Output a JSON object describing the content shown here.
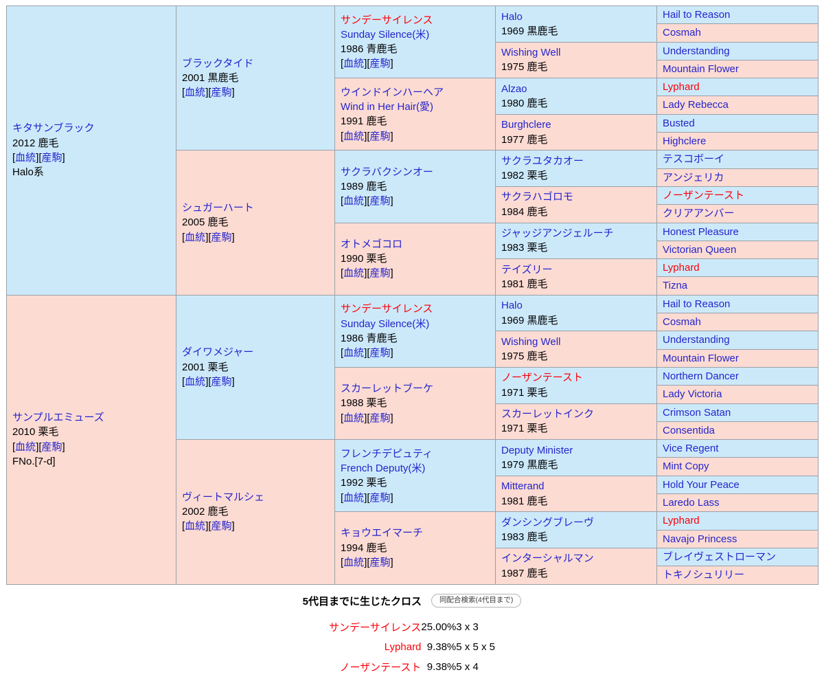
{
  "pedigree": {
    "subject": {
      "name": "キタサンブラック",
      "year_color": "2012 鹿毛",
      "links": [
        "血統",
        "産駒"
      ],
      "line": "Halo系",
      "sex": "m"
    },
    "dam_subject": {
      "name": "サンプルエミューズ",
      "year_color": "2010 栗毛",
      "links": [
        "血統",
        "産駒"
      ],
      "line": "FNo.[7-d]",
      "sex": "f"
    },
    "gen2": [
      {
        "name": "ブラックタイド",
        "year_color": "2001 黒鹿毛",
        "links": [
          "血統",
          "産駒"
        ],
        "sex": "m"
      },
      {
        "name": "シュガーハート",
        "year_color": "2005 鹿毛",
        "links": [
          "血統",
          "産駒"
        ],
        "sex": "f"
      },
      {
        "name": "ダイワメジャー",
        "year_color": "2001 栗毛",
        "links": [
          "血統",
          "産駒"
        ],
        "sex": "m"
      },
      {
        "name": "ヴィートマルシェ",
        "year_color": "2002 鹿毛",
        "links": [
          "血統",
          "産駒"
        ],
        "sex": "f"
      }
    ],
    "gen3": [
      {
        "name": "サンデーサイレンス",
        "en": "Sunday Silence(米)",
        "year_color": "1986 青鹿毛",
        "links": [
          "血統",
          "産駒"
        ],
        "sex": "m",
        "cross": true
      },
      {
        "name": "ウインドインハーヘア",
        "en": "Wind in Her Hair(愛)",
        "year_color": "1991 鹿毛",
        "links": [
          "血統",
          "産駒"
        ],
        "sex": "f",
        "cross": false
      },
      {
        "name": "サクラバクシンオー",
        "en": "",
        "year_color": "1989 鹿毛",
        "links": [
          "血統",
          "産駒"
        ],
        "sex": "m",
        "cross": false
      },
      {
        "name": "オトメゴコロ",
        "en": "",
        "year_color": "1990 栗毛",
        "links": [
          "血統",
          "産駒"
        ],
        "sex": "f",
        "cross": false
      },
      {
        "name": "サンデーサイレンス",
        "en": "Sunday Silence(米)",
        "year_color": "1986 青鹿毛",
        "links": [
          "血統",
          "産駒"
        ],
        "sex": "m",
        "cross": true
      },
      {
        "name": "スカーレットブーケ",
        "en": "",
        "year_color": "1988 栗毛",
        "links": [
          "血統",
          "産駒"
        ],
        "sex": "f",
        "cross": false
      },
      {
        "name": "フレンチデピュティ",
        "en": "French Deputy(米)",
        "year_color": "1992 栗毛",
        "links": [
          "血統",
          "産駒"
        ],
        "sex": "m",
        "cross": false
      },
      {
        "name": "キョウエイマーチ",
        "en": "",
        "year_color": "1994 鹿毛",
        "links": [
          "血統",
          "産駒"
        ],
        "sex": "f",
        "cross": false
      }
    ],
    "gen4": [
      {
        "name": "Halo",
        "year_color": "1969 黒鹿毛",
        "sex": "m",
        "cross": false
      },
      {
        "name": "Wishing Well",
        "year_color": "1975 鹿毛",
        "sex": "f",
        "cross": false
      },
      {
        "name": "Alzao",
        "year_color": "1980 鹿毛",
        "sex": "m",
        "cross": false
      },
      {
        "name": "Burghclere",
        "year_color": "1977 鹿毛",
        "sex": "f",
        "cross": false
      },
      {
        "name": "サクラユタカオー",
        "year_color": "1982 栗毛",
        "sex": "m",
        "cross": false
      },
      {
        "name": "サクラハゴロモ",
        "year_color": "1984 鹿毛",
        "sex": "f",
        "cross": false
      },
      {
        "name": "ジャッジアンジェルーチ",
        "year_color": "1983 栗毛",
        "sex": "m",
        "cross": false
      },
      {
        "name": "テイズリー",
        "year_color": "1981 鹿毛",
        "sex": "f",
        "cross": false
      },
      {
        "name": "Halo",
        "year_color": "1969 黒鹿毛",
        "sex": "m",
        "cross": false
      },
      {
        "name": "Wishing Well",
        "year_color": "1975 鹿毛",
        "sex": "f",
        "cross": false
      },
      {
        "name": "ノーザンテースト",
        "year_color": "1971 栗毛",
        "sex": "m",
        "cross": true
      },
      {
        "name": "スカーレットインク",
        "year_color": "1971 栗毛",
        "sex": "f",
        "cross": false
      },
      {
        "name": "Deputy Minister",
        "year_color": "1979 黒鹿毛",
        "sex": "m",
        "cross": false
      },
      {
        "name": "Mitterand",
        "year_color": "1981 鹿毛",
        "sex": "f",
        "cross": false
      },
      {
        "name": "ダンシングブレーヴ",
        "year_color": "1983 鹿毛",
        "sex": "m",
        "cross": false
      },
      {
        "name": "インターシャルマン",
        "year_color": "1987 鹿毛",
        "sex": "f",
        "cross": false
      }
    ],
    "gen5": [
      {
        "name": "Hail to Reason",
        "sex": "m",
        "cross": false
      },
      {
        "name": "Cosmah",
        "sex": "f",
        "cross": false
      },
      {
        "name": "Understanding",
        "sex": "m",
        "cross": false
      },
      {
        "name": "Mountain Flower",
        "sex": "f",
        "cross": false
      },
      {
        "name": "Lyphard",
        "sex": "m",
        "cross": true
      },
      {
        "name": "Lady Rebecca",
        "sex": "f",
        "cross": false
      },
      {
        "name": "Busted",
        "sex": "m",
        "cross": false
      },
      {
        "name": "Highclere",
        "sex": "f",
        "cross": false
      },
      {
        "name": "テスコボーイ",
        "sex": "m",
        "cross": false
      },
      {
        "name": "アンジェリカ",
        "sex": "f",
        "cross": false
      },
      {
        "name": "ノーザンテースト",
        "sex": "m",
        "cross": true
      },
      {
        "name": "クリアアンバー",
        "sex": "f",
        "cross": false
      },
      {
        "name": "Honest Pleasure",
        "sex": "m",
        "cross": false
      },
      {
        "name": "Victorian Queen",
        "sex": "f",
        "cross": false
      },
      {
        "name": "Lyphard",
        "sex": "m",
        "cross": true
      },
      {
        "name": "Tizna",
        "sex": "f",
        "cross": false
      },
      {
        "name": "Hail to Reason",
        "sex": "m",
        "cross": false
      },
      {
        "name": "Cosmah",
        "sex": "f",
        "cross": false
      },
      {
        "name": "Understanding",
        "sex": "m",
        "cross": false
      },
      {
        "name": "Mountain Flower",
        "sex": "f",
        "cross": false
      },
      {
        "name": "Northern Dancer",
        "sex": "m",
        "cross": false
      },
      {
        "name": "Lady Victoria",
        "sex": "f",
        "cross": false
      },
      {
        "name": "Crimson Satan",
        "sex": "m",
        "cross": false
      },
      {
        "name": "Consentida",
        "sex": "f",
        "cross": false
      },
      {
        "name": "Vice Regent",
        "sex": "m",
        "cross": false
      },
      {
        "name": "Mint Copy",
        "sex": "f",
        "cross": false
      },
      {
        "name": "Hold Your Peace",
        "sex": "m",
        "cross": false
      },
      {
        "name": "Laredo Lass",
        "sex": "f",
        "cross": false
      },
      {
        "name": "Lyphard",
        "sex": "m",
        "cross": true
      },
      {
        "name": "Navajo Princess",
        "sex": "f",
        "cross": false
      },
      {
        "name": "ブレイヴェストローマン",
        "sex": "m",
        "cross": false
      },
      {
        "name": "トキノシュリリー",
        "sex": "f",
        "cross": false
      }
    ]
  },
  "cross_section": {
    "title": "5代目までに生じたクロス",
    "button_label": "同配合検索(4代目まで)",
    "rows": [
      {
        "name": "サンデーサイレンス",
        "percent": "25.00%",
        "generations": "3 x 3"
      },
      {
        "name": "Lyphard",
        "percent": "9.38%",
        "generations": "5 x 5 x 5"
      },
      {
        "name": "ノーザンテースト",
        "percent": "9.38%",
        "generations": "5 x 4"
      }
    ]
  },
  "colors": {
    "male_bg": "#cce9fa",
    "female_bg": "#fcdbd3",
    "link_blue": "#2424cc",
    "cross_red": "#fb0007",
    "border": "#9aa0a6"
  }
}
